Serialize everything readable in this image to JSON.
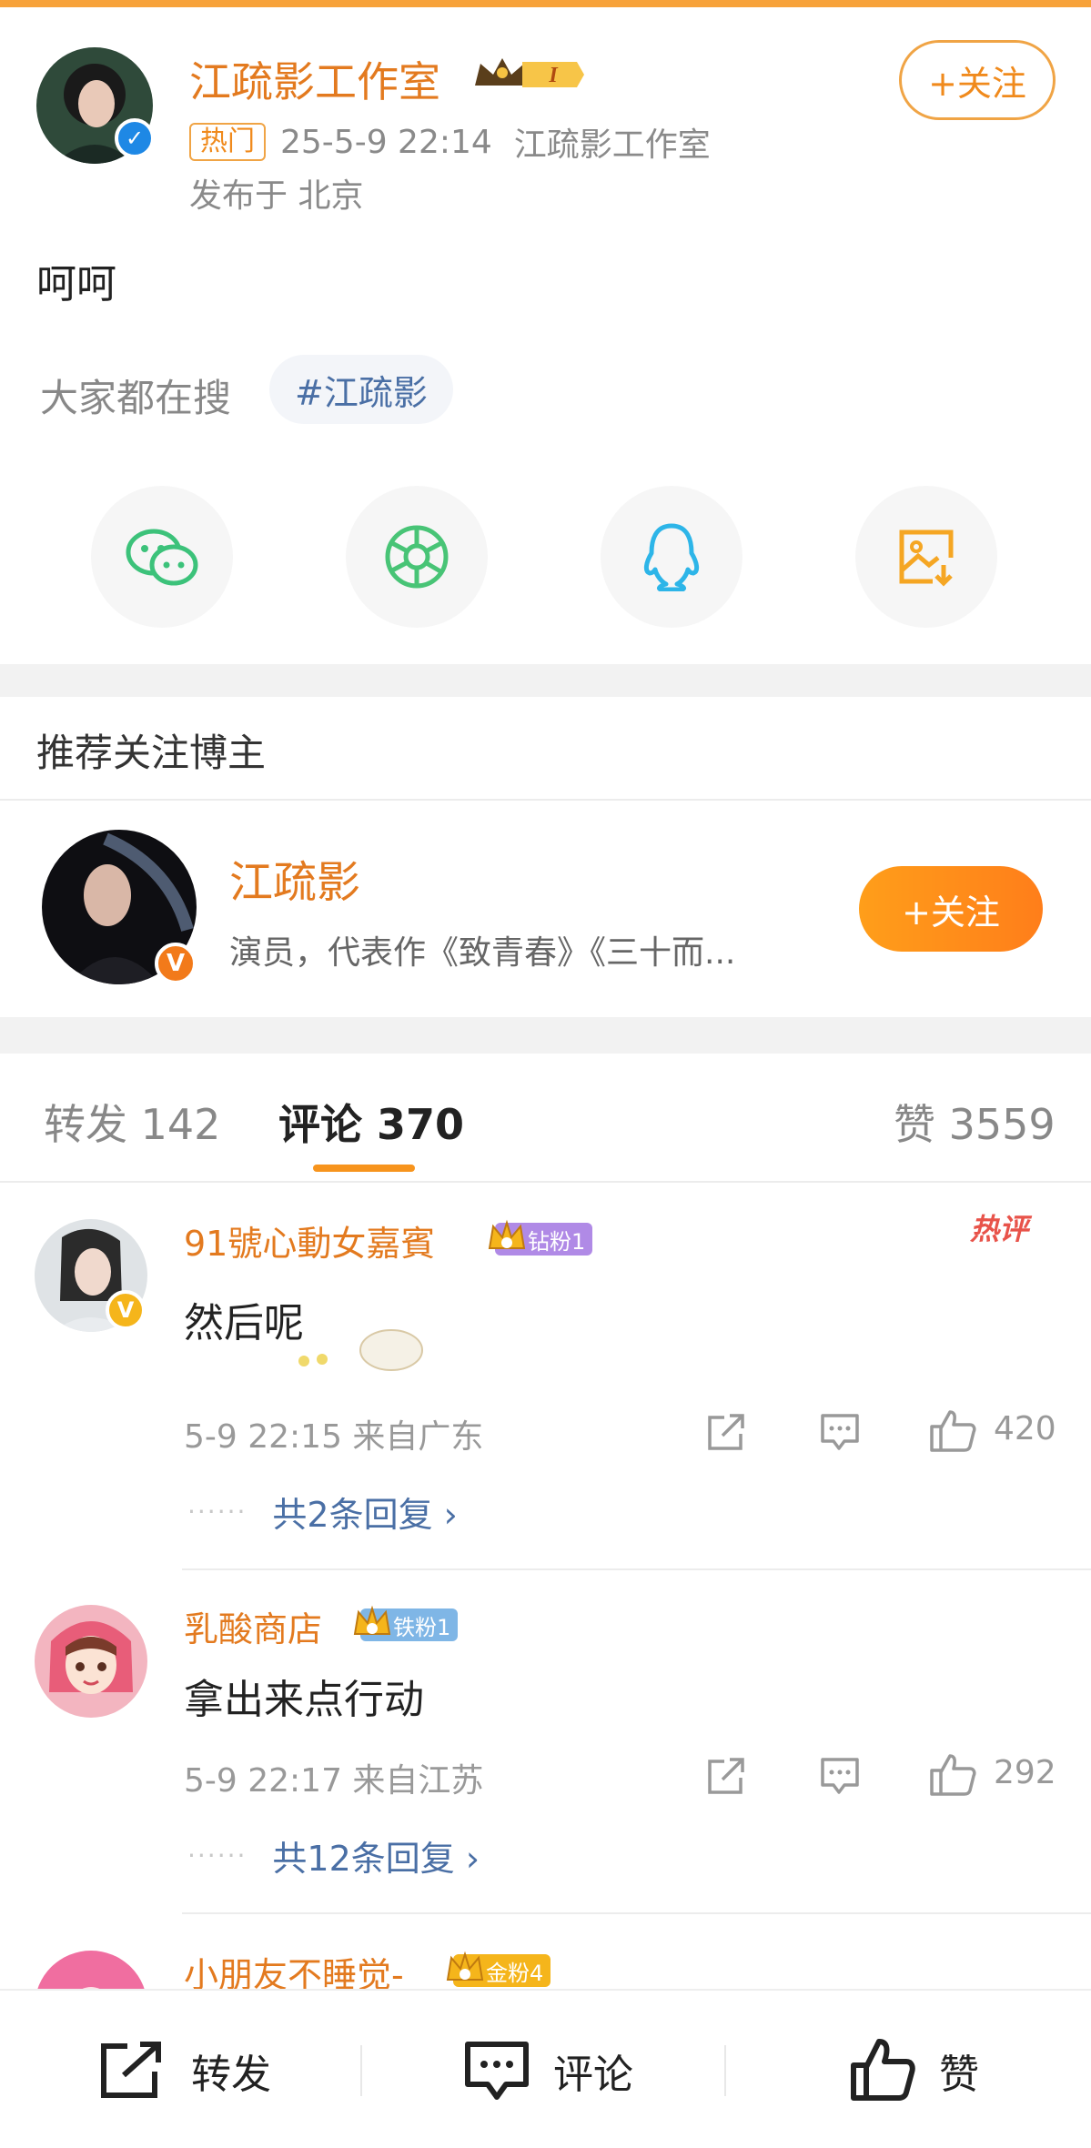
{
  "post": {
    "author": "江疏影工作室",
    "author_level": "I",
    "follow_label": "+关注",
    "hot_tag": "热门",
    "time": "25-5-9 22:14",
    "source": "江疏影工作室",
    "location": "发布于 北京",
    "text": "呵呵",
    "search_label": "大家都在搜",
    "search_chip": "#江疏影",
    "share_icons": [
      "wechat-icon",
      "moments-icon",
      "qq-icon",
      "save-image-icon"
    ]
  },
  "recommend": {
    "title": "推荐关注博主",
    "name": "江疏影",
    "desc": "演员，代表作《致青春》《三十而...",
    "follow_label": "+关注"
  },
  "tabs": {
    "repost": "转发 142",
    "comment": "评论 370",
    "like": "赞 3559"
  },
  "hot_comment_label": "热评",
  "comments": [
    {
      "user": "91號心動女嘉賓",
      "fan_badge": "钻粉1",
      "text": "然后呢",
      "meta": "5-9 22:15 来自广东",
      "likes": "420",
      "replies": "共2条回复 ›"
    },
    {
      "user": "乳酸商店",
      "fan_badge": "铁粉1",
      "text": "拿出来点行动",
      "meta": "5-9 22:17 来自江苏",
      "likes": "292",
      "replies": "共12条回复 ›"
    },
    {
      "user": "小朋友不睡觉-",
      "fan_badge": "金粉4"
    }
  ],
  "bottom_bar": {
    "repost": "转发",
    "comment": "评论",
    "like": "赞"
  },
  "colors": {
    "accent_orange": "#f7941d",
    "name_orange": "#e37a1f",
    "link_blue": "#4a6fa5",
    "verified_blue": "#1e88e5",
    "verified_gold": "#f5a623"
  }
}
